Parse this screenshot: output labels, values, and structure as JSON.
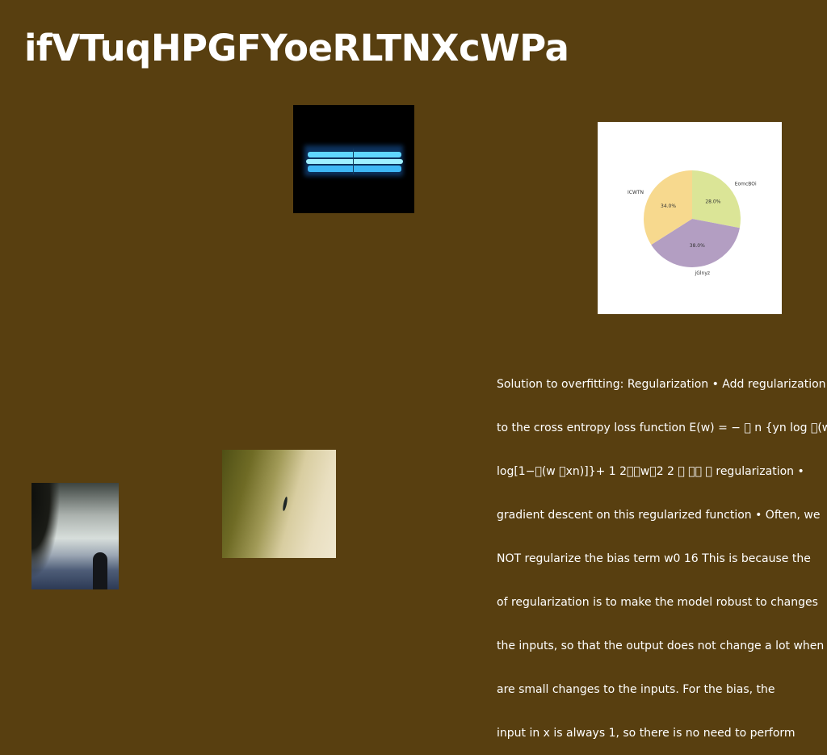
{
  "title": "ifVTuqHPGFYoeRLTNXcWPa",
  "images": {
    "lamp": "glowing blue tube lamp on black background",
    "storm": "stormy sky over mountains with dark silhouette",
    "paper": "textured olive and cream surface with small dark object"
  },
  "body_lines": [
    "Solution to overfitting: Regularization • Add regularization",
    "to the cross entropy loss function E(w) = − \u0000 n {yn log \u0000(w",
    "log[1−\u0000(w \u0000xn)]}+ 1 2\u0000\u0000w\u00002 2 \u0000 \u0000\u0000 \u0000 regularization •",
    "gradient descent on this regularized function • Often, we",
    "NOT regularize the bias term w0 16 This is because the",
    "of regularization is to make the model robust to changes",
    "the inputs, so that the output does not change a lot when",
    "are small changes to the inputs. For the bias, the",
    "input in x is always 1, so there is no need to perform"
  ],
  "chart_data": {
    "type": "pie",
    "title": "",
    "labels": [
      "EomcBOi",
      "jGlnyz",
      "ICWTN"
    ],
    "values": [
      28.0,
      38.0,
      34.0
    ],
    "value_labels": [
      "28.0%",
      "38.0%",
      "34.0%"
    ],
    "colors": [
      "#dbe597",
      "#b39ec2",
      "#f7d98e"
    ],
    "start": "12 o'clock, clockwise"
  }
}
